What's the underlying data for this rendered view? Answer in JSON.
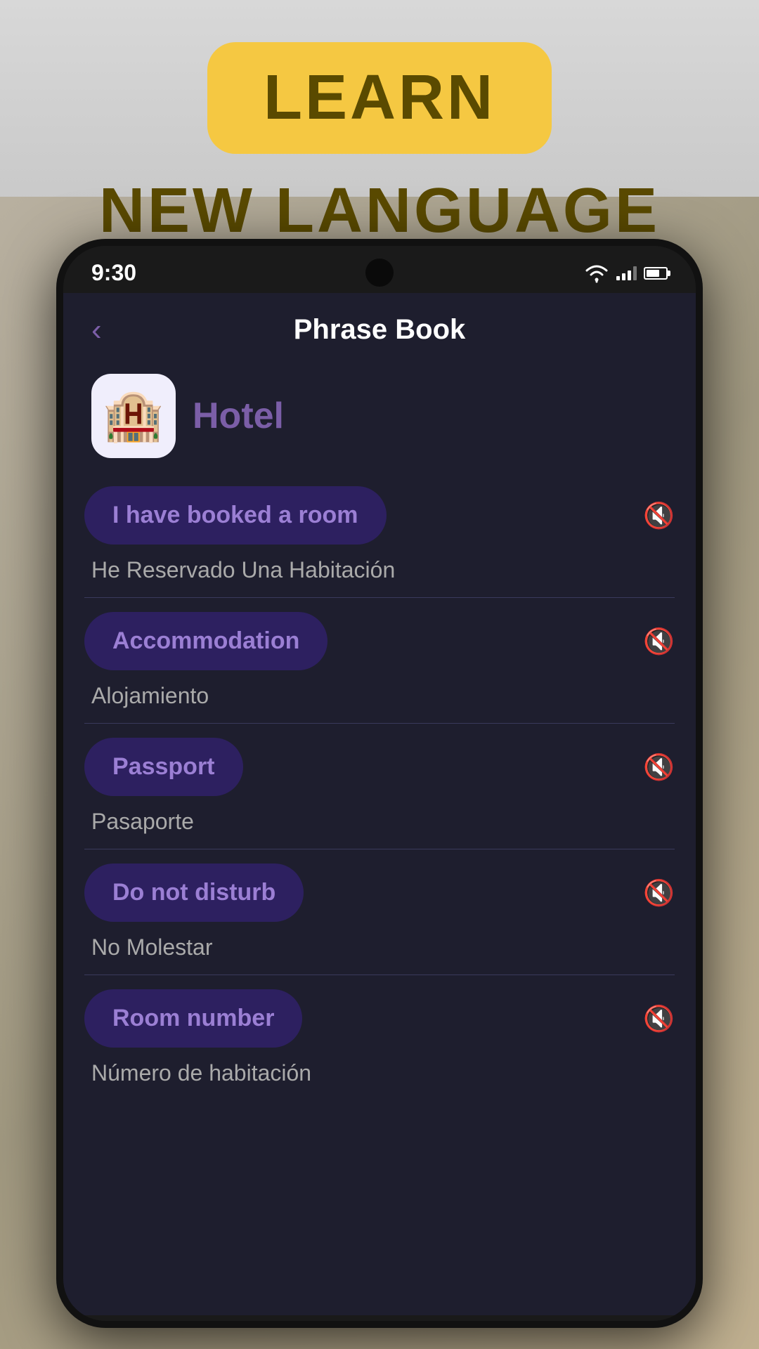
{
  "background": {
    "color": "#c8c8c8"
  },
  "header": {
    "learn_label": "LEARN",
    "new_language_label": "NEW LANGUAGE",
    "badge_color": "#f5c842",
    "text_color": "#5a4a00"
  },
  "status_bar": {
    "time": "9:30",
    "wifi": true,
    "signal": true,
    "battery": true
  },
  "app": {
    "title": "Phrase Book",
    "back_label": "‹",
    "category": {
      "icon": "🏨",
      "name": "Hotel"
    },
    "phrases": [
      {
        "phrase": "I have booked a room",
        "translation": "He Reservado Una Habitación"
      },
      {
        "phrase": "Accommodation",
        "translation": "Alojamiento"
      },
      {
        "phrase": "Passport",
        "translation": "Pasaporte"
      },
      {
        "phrase": "Do not disturb",
        "translation": "No Molestar"
      },
      {
        "phrase": "Room number",
        "translation": "Número de habitación"
      }
    ]
  }
}
